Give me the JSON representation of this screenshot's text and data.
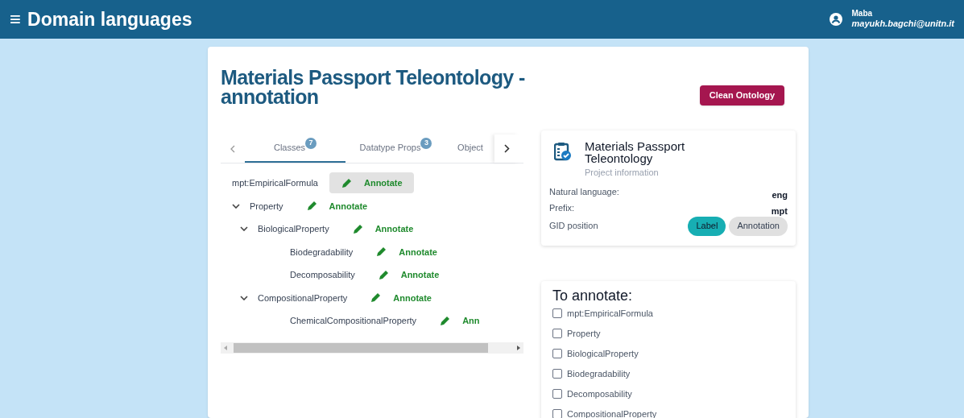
{
  "header": {
    "menu_glyph": "≡",
    "title": "Domain languages",
    "user": {
      "name": "Maba",
      "email": "mayukh.bagchi@unitn.it"
    }
  },
  "page": {
    "title": "Materials Passport Teleontology -",
    "subtitle": "annotation",
    "clean_button": "Clean Ontology"
  },
  "tabs": [
    {
      "label": "Classes",
      "count": "7",
      "selected": true
    },
    {
      "label": "Datatype Props",
      "count": "3",
      "selected": false
    },
    {
      "label": "Object",
      "selected": false
    }
  ],
  "tree": [
    {
      "label": "mpt:EmpiricalFormula",
      "action": "Annotate",
      "selected": true
    },
    {
      "label": "Property",
      "action": "Annotate",
      "selected": false,
      "expanded": true,
      "children": [
        {
          "label": "BiologicalProperty",
          "action": "Annotate",
          "selected": false,
          "expanded": true,
          "children": [
            {
              "label": "Biodegradability",
              "action": "Annotate",
              "selected": false
            },
            {
              "label": "Decomposability",
              "action": "Annotate",
              "selected": false
            }
          ]
        },
        {
          "label": "CompositionalProperty",
          "action": "Annotate",
          "selected": false,
          "expanded": true,
          "children": [
            {
              "label": "ChemicalCompositionalProperty",
              "action": "Ann",
              "selected": false
            }
          ]
        }
      ]
    }
  ],
  "project": {
    "title": "Materials Passport Teleontology",
    "subtitle": "Project information",
    "fields": [
      {
        "label": "Natural language:",
        "value": "eng"
      },
      {
        "label": "Prefix:",
        "value": "mpt"
      }
    ],
    "gid": {
      "label": "GID position",
      "options": [
        {
          "label": "Label",
          "selected": true
        },
        {
          "label": "Annotation",
          "selected": false
        }
      ]
    }
  },
  "to_annotate": {
    "title": "To annotate:",
    "items": [
      {
        "label": "mpt:EmpiricalFormula",
        "checked": false
      },
      {
        "label": "Property",
        "checked": false
      },
      {
        "label": "BiologicalProperty",
        "checked": false
      },
      {
        "label": "Biodegradability",
        "checked": false
      },
      {
        "label": "Decomposability",
        "checked": false
      },
      {
        "label": "CompositionalProperty",
        "checked": false
      }
    ]
  }
}
